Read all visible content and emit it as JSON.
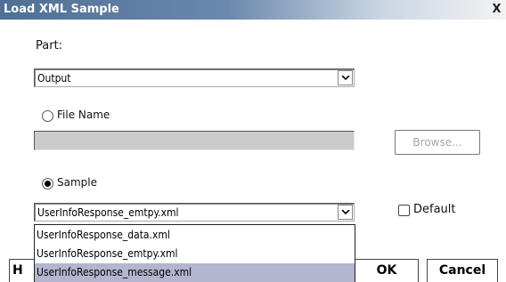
{
  "window": {
    "title": "Load XML Sample",
    "close_label": "X"
  },
  "part": {
    "label": "Part:",
    "selected": "Output"
  },
  "file_name": {
    "label": "File Name",
    "selected": false,
    "browse_label": "Browse..."
  },
  "sample": {
    "label": "Sample",
    "selected": true,
    "current_value": "UserInfoResponse_emtpy.xml",
    "options": [
      "UserInfoResponse_data.xml",
      "UserInfoResponse_emtpy.xml",
      "UserInfoResponse_message.xml"
    ],
    "highlighted_index": 2
  },
  "default_checkbox": {
    "label": "Default",
    "checked": false
  },
  "footer": {
    "partial_label": "H",
    "ok_label": "OK",
    "cancel_label": "Cancel"
  },
  "colors": {
    "titlebar_start": "#4f6f94",
    "selection_highlight": "#b4b6cf",
    "disabled_field": "#cbcbcb"
  }
}
